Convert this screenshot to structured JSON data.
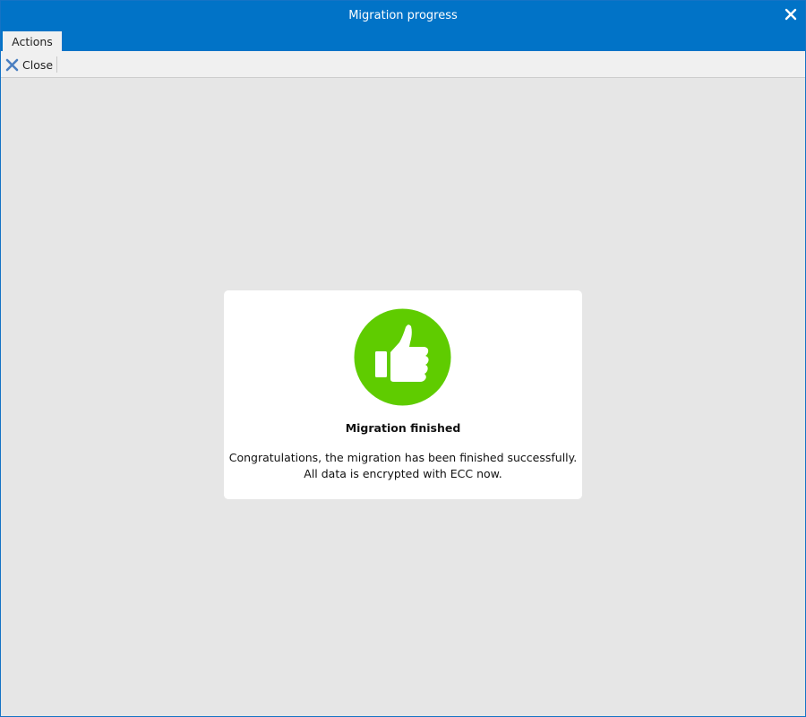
{
  "window": {
    "title": "Migration progress",
    "close_icon": "close-icon"
  },
  "ribbon": {
    "tabs": [
      {
        "label": "Actions",
        "selected": true
      }
    ]
  },
  "toolbar": {
    "buttons": [
      {
        "label": "Close",
        "icon": "close-x-icon"
      }
    ]
  },
  "result": {
    "icon": "thumbs-up-icon",
    "title": "Migration finished",
    "message_line1": "Congratulations, the migration has been finished successfully.",
    "message_line2": "All data is encrypted with ECC now."
  },
  "colors": {
    "titlebar": "#0173c7",
    "success": "#5fcc00",
    "background": "#e6e6e6"
  }
}
